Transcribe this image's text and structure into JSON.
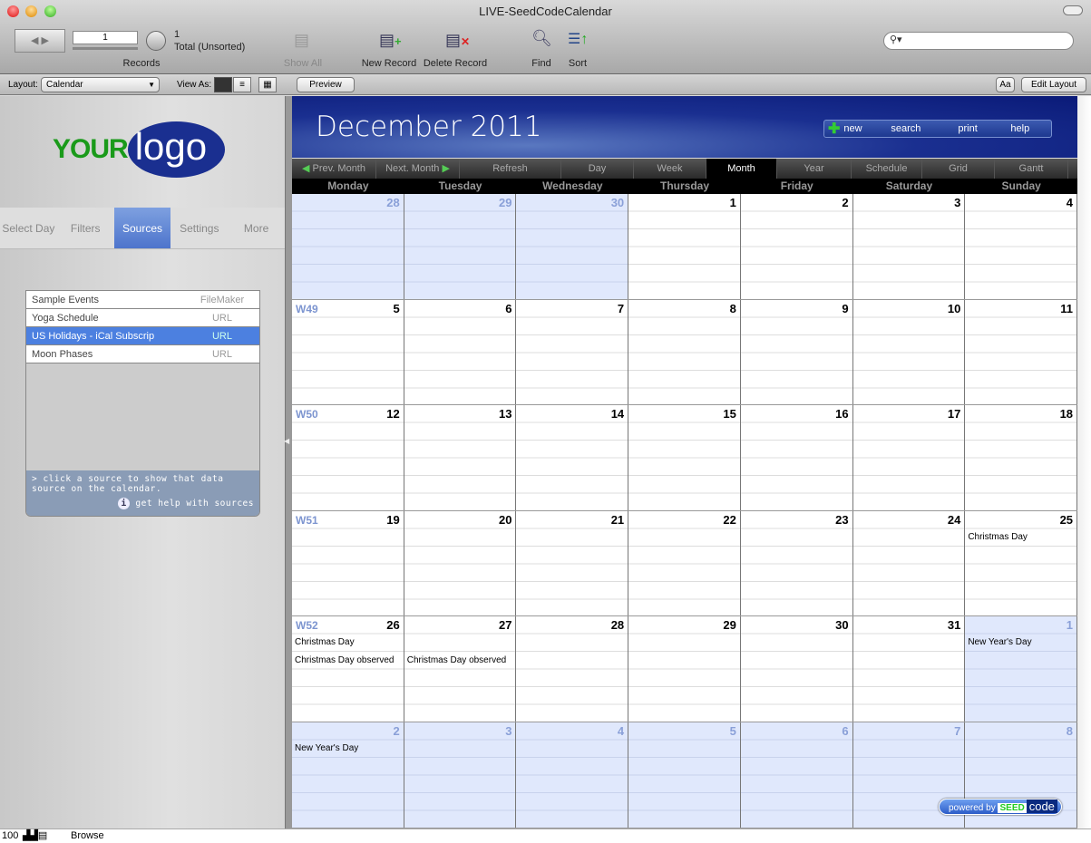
{
  "window": {
    "title": "LIVE-SeedCodeCalendar"
  },
  "toolbar": {
    "record_value": "1",
    "found_count": "1",
    "total_label": "Total (Unsorted)",
    "records_label": "Records",
    "show_all": "Show All",
    "new_record": "New Record",
    "delete_record": "Delete Record",
    "find": "Find",
    "sort": "Sort",
    "search_placeholder": ""
  },
  "layoutbar": {
    "layout_label": "Layout:",
    "layout_value": "Calendar",
    "view_as_label": "View As:",
    "preview": "Preview",
    "font_button": "Aa",
    "edit_layout": "Edit Layout"
  },
  "sidebar": {
    "logo": "YOURlogo",
    "logo_your": "YOUR",
    "logo_logo": "logo",
    "tabs": [
      {
        "label": "Select Day"
      },
      {
        "label": "Filters"
      },
      {
        "label": "Sources",
        "active": true
      },
      {
        "label": "Settings"
      },
      {
        "label": "More"
      }
    ],
    "sources": [
      {
        "name": "Sample Events",
        "type": "FileMaker"
      },
      {
        "name": "Yoga Schedule",
        "type": "URL"
      },
      {
        "name": "US Holidays - iCal Subscrip",
        "type": "URL",
        "selected": true
      },
      {
        "name": "Moon Phases",
        "type": "URL"
      }
    ],
    "help_text": "> click a source to show that data source on the calendar.",
    "help_link": "get help with sources"
  },
  "calendar": {
    "title": "December 2011",
    "header_buttons": [
      "new",
      "search",
      "print",
      "help"
    ],
    "nav": [
      {
        "label": "Prev. Month"
      },
      {
        "label": "Next. Month"
      },
      {
        "label": "Refresh"
      },
      {
        "label": "Day"
      },
      {
        "label": "Week"
      },
      {
        "label": "Month",
        "active": true
      },
      {
        "label": "Year"
      },
      {
        "label": "Schedule"
      },
      {
        "label": "Grid"
      },
      {
        "label": "Gantt"
      }
    ],
    "weekdays": [
      "Monday",
      "Tuesday",
      "Wednesday",
      "Thursday",
      "Friday",
      "Saturday",
      "Sunday"
    ],
    "weeks": [
      {
        "label": "",
        "days": [
          {
            "n": "28",
            "other": true
          },
          {
            "n": "29",
            "other": true
          },
          {
            "n": "30",
            "other": true
          },
          {
            "n": "1"
          },
          {
            "n": "2"
          },
          {
            "n": "3"
          },
          {
            "n": "4"
          }
        ]
      },
      {
        "label": "W49",
        "days": [
          {
            "n": "5"
          },
          {
            "n": "6"
          },
          {
            "n": "7"
          },
          {
            "n": "8"
          },
          {
            "n": "9"
          },
          {
            "n": "10"
          },
          {
            "n": "11"
          }
        ]
      },
      {
        "label": "W50",
        "days": [
          {
            "n": "12"
          },
          {
            "n": "13"
          },
          {
            "n": "14"
          },
          {
            "n": "15"
          },
          {
            "n": "16"
          },
          {
            "n": "17"
          },
          {
            "n": "18"
          }
        ]
      },
      {
        "label": "W51",
        "days": [
          {
            "n": "19"
          },
          {
            "n": "20"
          },
          {
            "n": "21"
          },
          {
            "n": "22"
          },
          {
            "n": "23"
          },
          {
            "n": "24"
          },
          {
            "n": "25",
            "events": [
              "Christmas Day"
            ]
          }
        ]
      },
      {
        "label": "W52",
        "days": [
          {
            "n": "26",
            "events": [
              "Christmas Day",
              "Christmas Day observed"
            ]
          },
          {
            "n": "27",
            "events": [
              "",
              "Christmas Day observed"
            ]
          },
          {
            "n": "28"
          },
          {
            "n": "29"
          },
          {
            "n": "30"
          },
          {
            "n": "31"
          },
          {
            "n": "1",
            "other": true,
            "events": [
              "New Year's Day"
            ]
          }
        ]
      },
      {
        "label": "",
        "days": [
          {
            "n": "2",
            "other": true,
            "events": [
              "New Year's Day"
            ]
          },
          {
            "n": "3",
            "other": true
          },
          {
            "n": "4",
            "other": true
          },
          {
            "n": "5",
            "other": true
          },
          {
            "n": "6",
            "other": true
          },
          {
            "n": "7",
            "other": true
          },
          {
            "n": "8",
            "other": true
          }
        ]
      }
    ],
    "powered_by": "powered by",
    "brand_seed": "SEED",
    "brand_code": "code"
  },
  "status": {
    "zoom": "100",
    "mode": "Browse"
  }
}
